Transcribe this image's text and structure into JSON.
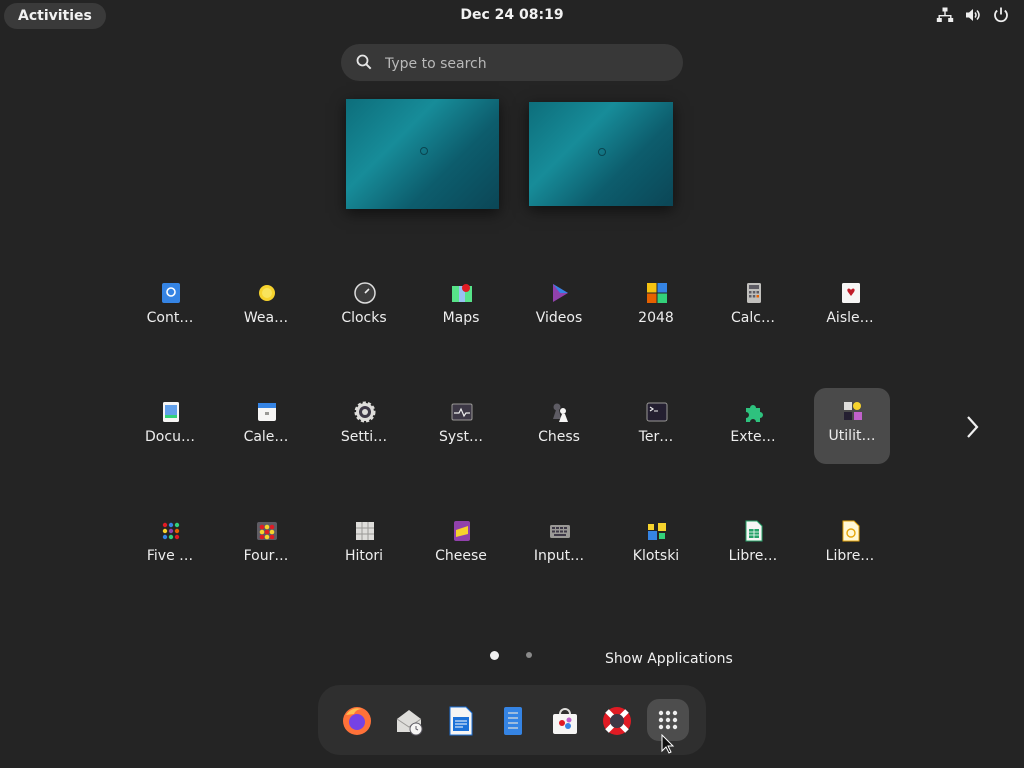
{
  "topbar": {
    "activities_label": "Activities",
    "clock": "Dec 24  08:19",
    "tray_icons": [
      "network-icon",
      "volume-icon",
      "power-icon"
    ]
  },
  "search": {
    "placeholder": "Type to search"
  },
  "workspaces": [
    "workspace-1",
    "workspace-2"
  ],
  "apps": [
    {
      "label": "Cont…",
      "icon": "contacts-icon"
    },
    {
      "label": "Wea…",
      "icon": "weather-icon"
    },
    {
      "label": "Clocks",
      "icon": "clocks-icon"
    },
    {
      "label": "Maps",
      "icon": "maps-icon"
    },
    {
      "label": "Videos",
      "icon": "videos-icon"
    },
    {
      "label": "2048",
      "icon": "2048-icon"
    },
    {
      "label": "Calc…",
      "icon": "calculator-icon"
    },
    {
      "label": "Aisle…",
      "icon": "aisleriot-icon"
    },
    {
      "label": "Docu…",
      "icon": "document-viewer-icon"
    },
    {
      "label": "Cale…",
      "icon": "calendar-icon"
    },
    {
      "label": "Setti…",
      "icon": "settings-icon"
    },
    {
      "label": "Syst…",
      "icon": "system-monitor-icon"
    },
    {
      "label": "Chess",
      "icon": "chess-icon"
    },
    {
      "label": "Ter…",
      "icon": "terminal-icon"
    },
    {
      "label": "Exte…",
      "icon": "extensions-icon"
    },
    {
      "label": "Utilit…",
      "icon": "utilities-folder-icon",
      "selected": true
    },
    {
      "label": "Five …",
      "icon": "five-or-more-icon"
    },
    {
      "label": "Four…",
      "icon": "four-in-a-row-icon"
    },
    {
      "label": "Hitori",
      "icon": "hitori-icon"
    },
    {
      "label": "Cheese",
      "icon": "cheese-icon"
    },
    {
      "label": "Input…",
      "icon": "input-method-icon"
    },
    {
      "label": "Klotski",
      "icon": "klotski-icon"
    },
    {
      "label": "Libre…",
      "icon": "libreoffice-calc-icon"
    },
    {
      "label": "Libre…",
      "icon": "libreoffice-draw-icon"
    }
  ],
  "pagination": {
    "current_page": 1,
    "total_pages": 2
  },
  "tooltip": "Show Applications",
  "dock": [
    {
      "icon": "firefox-icon"
    },
    {
      "icon": "evolution-mail-icon"
    },
    {
      "icon": "libreoffice-writer-icon"
    },
    {
      "icon": "text-editor-icon"
    },
    {
      "icon": "software-center-icon"
    },
    {
      "icon": "help-icon"
    },
    {
      "icon": "show-applications-icon",
      "active": true
    }
  ],
  "colors": {
    "background": "#242424",
    "selected_tile": "#4a4a4a",
    "workspace_teal": "#178c99"
  }
}
